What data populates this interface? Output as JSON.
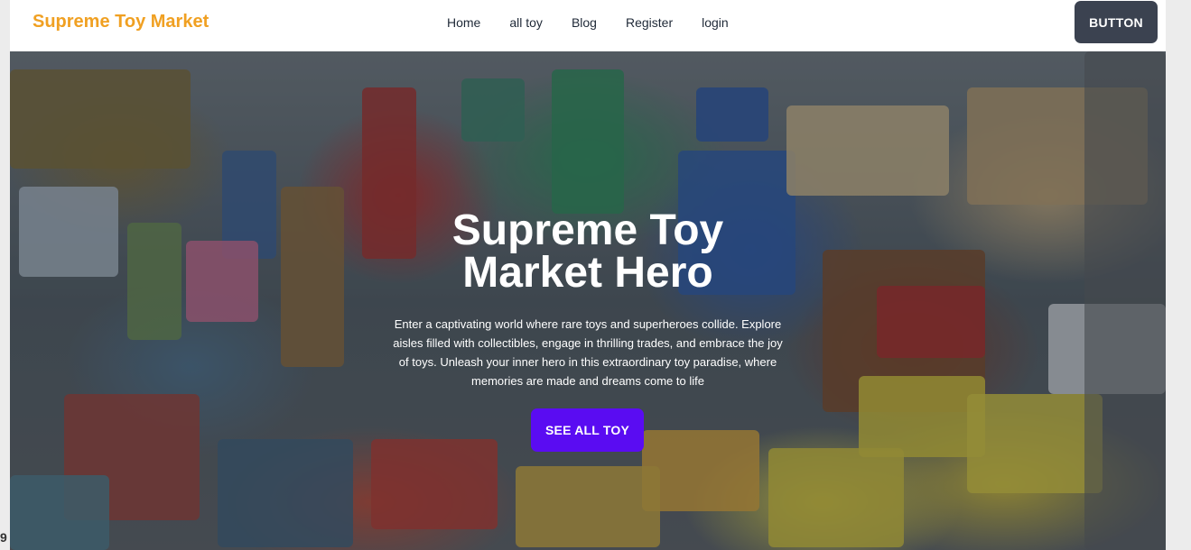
{
  "navbar": {
    "brand": "Supreme Toy Market",
    "links": [
      "Home",
      "all toy",
      "Blog",
      "Register",
      "login"
    ],
    "button_label": "BUTTON",
    "brand_color": "#f0a022",
    "button_color": "#3b4250"
  },
  "hero": {
    "title": "Supreme Toy Market Hero",
    "description": "Enter a captivating world where rare toys and superheroes collide. Explore aisles filled with collectibles, engage in thrilling trades, and embrace the joy of toys. Unleash your inner hero in this extraordinary toy paradise, where memories are made and dreams come to life",
    "cta_label": "SEE ALL TOY",
    "cta_color": "#5a0cf2",
    "background_image": "toy-market-photo"
  },
  "edge_mark": "9"
}
